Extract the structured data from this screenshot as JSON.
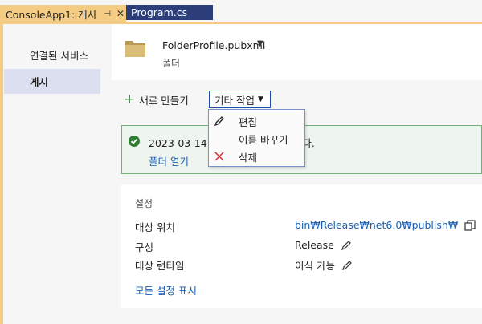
{
  "tabs": {
    "active_label": "ConsoleApp1: 게시",
    "inactive_label": "Program.cs",
    "pin_glyph": "⊣",
    "close_glyph": "✕"
  },
  "sidebar": {
    "items": [
      {
        "label": "연결된 서비스"
      },
      {
        "label": "게시"
      }
    ]
  },
  "profile": {
    "name": "FolderProfile.pubxml",
    "type": "폴더"
  },
  "toolbar": {
    "new_label": "새로 만들기",
    "other_label": "기타 작업"
  },
  "menu": {
    "items": [
      {
        "label": "편집",
        "icon": "pencil-icon"
      },
      {
        "label": "이름 바꾸기",
        "icon": ""
      },
      {
        "label": "삭제",
        "icon": "delete-x-icon"
      }
    ]
  },
  "status": {
    "message": "2023-03-14 오                          다.",
    "open_folder": "폴더 열기"
  },
  "settings": {
    "title": "설정",
    "rows": [
      {
        "label": "대상 위치",
        "value": "bin₩Release₩net6.0₩publish₩"
      },
      {
        "label": "구성",
        "value": "Release"
      },
      {
        "label": "대상 런타임",
        "value": "이식 가능"
      }
    ],
    "show_all": "모든 설정 표시"
  },
  "colors": {
    "accent_tab": "#f5cc84",
    "inactive_tab": "#2c3e7a",
    "link": "#1a5fb4",
    "success": "#2e7d32"
  }
}
